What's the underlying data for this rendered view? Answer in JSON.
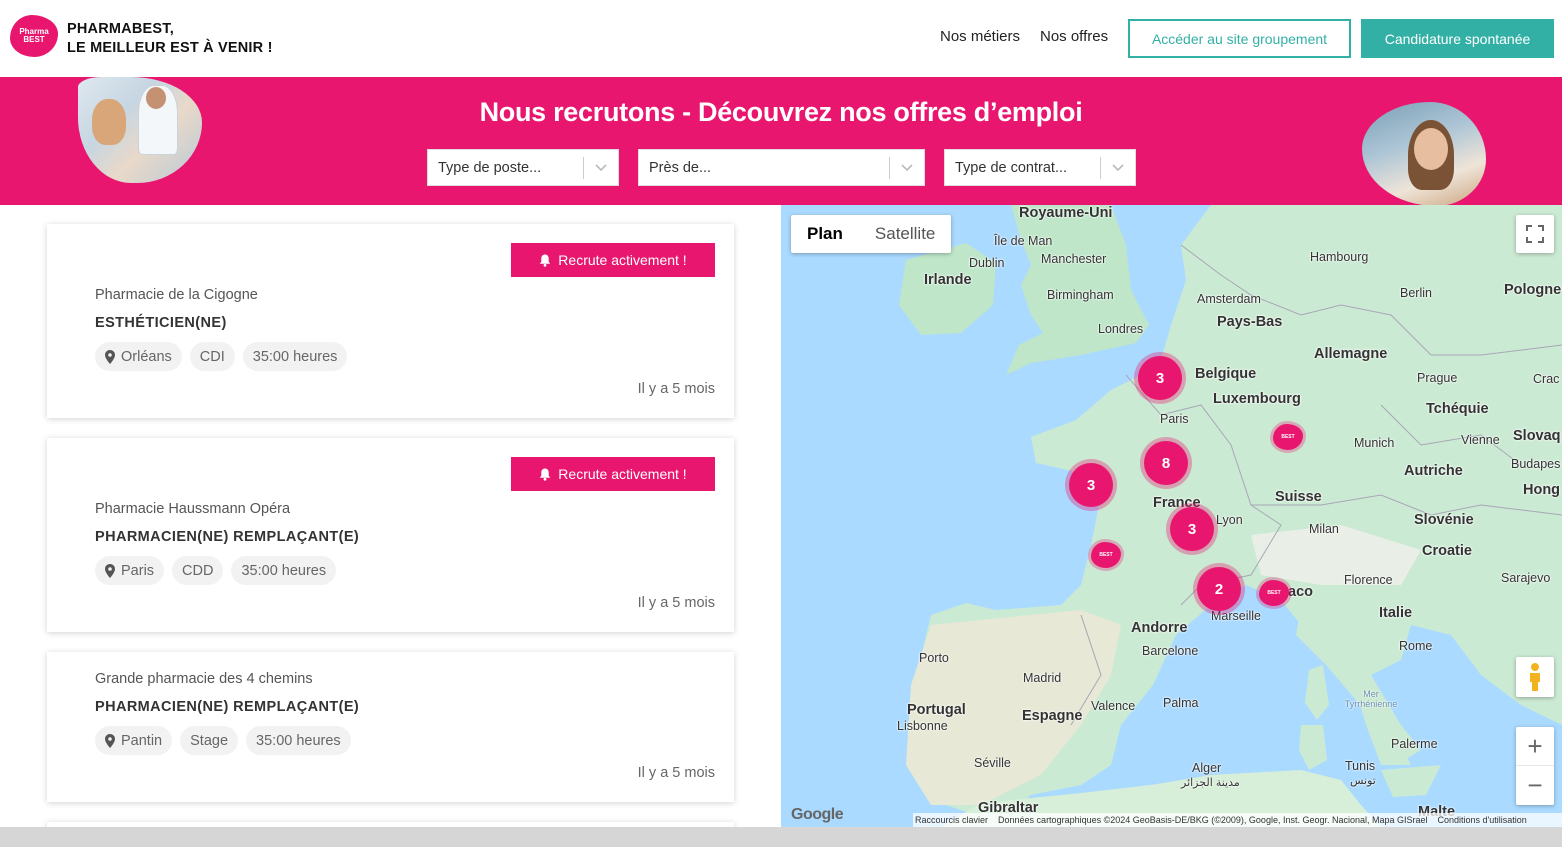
{
  "header": {
    "logo_text": "Pharma BEST",
    "brand_line1": "PHARMABEST,",
    "brand_line2": "LE MEILLEUR EST À VENIR !",
    "nav": [
      "Nos métiers",
      "Nos offres"
    ],
    "btn_outline": "Accéder au site groupement",
    "btn_fill": "Candidature spontanée"
  },
  "banner": {
    "title": "Nous recrutons - Découvrez nos offres d’emploi",
    "filters": [
      {
        "placeholder": "Type de poste..."
      },
      {
        "placeholder": "Près de..."
      },
      {
        "placeholder": "Type de contrat..."
      }
    ]
  },
  "offers": [
    {
      "badge": "Recrute activement !",
      "pharmacy": "Pharmacie de la Cigogne",
      "job": "ESTHÉTICIEN(NE)",
      "city": "Orléans",
      "contract": "CDI",
      "hours": "35:00 heures",
      "age": "Il y a 5 mois"
    },
    {
      "badge": "Recrute activement !",
      "pharmacy": "Pharmacie Haussmann Opéra",
      "job": "PHARMACIEN(NE) REMPLAÇANT(E)",
      "city": "Paris",
      "contract": "CDD",
      "hours": "35:00 heures",
      "age": "Il y a 5 mois"
    },
    {
      "badge": "",
      "pharmacy": "Grande pharmacie des 4 chemins",
      "job": "PHARMACIEN(NE) REMPLAÇANT(E)",
      "city": "Pantin",
      "contract": "Stage",
      "hours": "35:00 heures",
      "age": "Il y a 5 mois"
    }
  ],
  "map": {
    "type_plan": "Plan",
    "type_satellite": "Satellite",
    "clusters": [
      "3",
      "8",
      "3",
      "3",
      "2"
    ],
    "labels": {
      "royaume_uni": "Royaume-Uni",
      "ile_de_man": "Île de Man",
      "dublin": "Dublin",
      "manchester": "Manchester",
      "irlande": "Irlande",
      "birmingham": "Birmingham",
      "londres": "Londres",
      "hambourg": "Hambourg",
      "amsterdam": "Amsterdam",
      "pays_bas": "Pays-Bas",
      "berlin": "Berlin",
      "pologne": "Pologne",
      "allemagne": "Allemagne",
      "belgique": "Belgique",
      "luxembourg": "Luxembourg",
      "prague": "Prague",
      "crac": "Crac",
      "paris": "Paris",
      "tcheque": "Tchéquie",
      "munich": "Munich",
      "vienne": "Vienne",
      "slovaq": "Slovaq",
      "budapest": "Budapes",
      "autriche": "Autriche",
      "hong": "Hong",
      "france": "France",
      "suisse": "Suisse",
      "lyon": "Lyon",
      "slovenie": "Slovénie",
      "milan": "Milan",
      "croatie": "Croatie",
      "florence": "Florence",
      "sarajevo": "Sarajevo",
      "monaco": "aco",
      "marseille": "Marseille",
      "italie": "Italie",
      "andorre": "Andorre",
      "barcelone": "Barcelone",
      "rome": "Rome",
      "porto": "Porto",
      "madrid": "Madrid",
      "portugal": "Portugal",
      "espagne": "Espagne",
      "valence": "Valence",
      "palma": "Palma",
      "mer_tyr": "Mer Tyrrhénienne",
      "lisbonne": "Lisbonne",
      "palerme": "Palerme",
      "seville": "Séville",
      "alger": "Alger",
      "alger_ar": "مدينة الجزائر",
      "tunis": "Tunis",
      "tunis_ar": "تونس",
      "gibraltar": "Gibraltar",
      "malte": "Malte"
    },
    "google": "Google",
    "attribution": [
      "Raccourcis clavier",
      "Données cartographiques ©2024 GeoBasis-DE/BKG (©2009), Google, Inst. Geogr. Nacional, Mapa GISrael",
      "Conditions d'utilisation"
    ],
    "zoom_in": "+",
    "zoom_out": "−"
  },
  "colors": {
    "brand_pink": "#e8166f",
    "teal": "#33b0a6"
  }
}
